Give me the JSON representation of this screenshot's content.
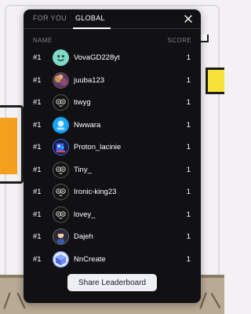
{
  "tabs": {
    "for_you": "FOR YOU",
    "global": "GLOBAL",
    "active": "global"
  },
  "columns": {
    "name": "NAME",
    "score": "SCORE"
  },
  "entries": [
    {
      "rank": "#1",
      "name": "VovaGD228yt",
      "score": "1",
      "avatar": "mint-face-avatar"
    },
    {
      "rank": "#1",
      "name": "juuba123",
      "score": "1",
      "avatar": "photo-avatar"
    },
    {
      "rank": "#1",
      "name": "tiwyg",
      "score": "1",
      "avatar": "default-owl-avatar"
    },
    {
      "rank": "#1",
      "name": "Nwwara",
      "score": "1",
      "avatar": "blue-avatar"
    },
    {
      "rank": "#1",
      "name": "Proton_lacinie",
      "score": "1",
      "avatar": "pixel-avatar"
    },
    {
      "rank": "#1",
      "name": "Tiny_",
      "score": "1",
      "avatar": "default-owl-avatar"
    },
    {
      "rank": "#1",
      "name": "Ironic-king23",
      "score": "1",
      "avatar": "default-owl-avatar"
    },
    {
      "rank": "#1",
      "name": "lovey_",
      "score": "1",
      "avatar": "default-owl-avatar"
    },
    {
      "rank": "#1",
      "name": "Dajeh",
      "score": "1",
      "avatar": "character-avatar"
    },
    {
      "rank": "#1",
      "name": "NnCreate",
      "score": "1",
      "avatar": "cube-avatar"
    }
  ],
  "share_label": "Share Leaderboard",
  "icons": {
    "close": "close-icon"
  },
  "colors": {
    "panel": "#111114",
    "button": "#eef0f6",
    "muted": "#8c8c94"
  }
}
